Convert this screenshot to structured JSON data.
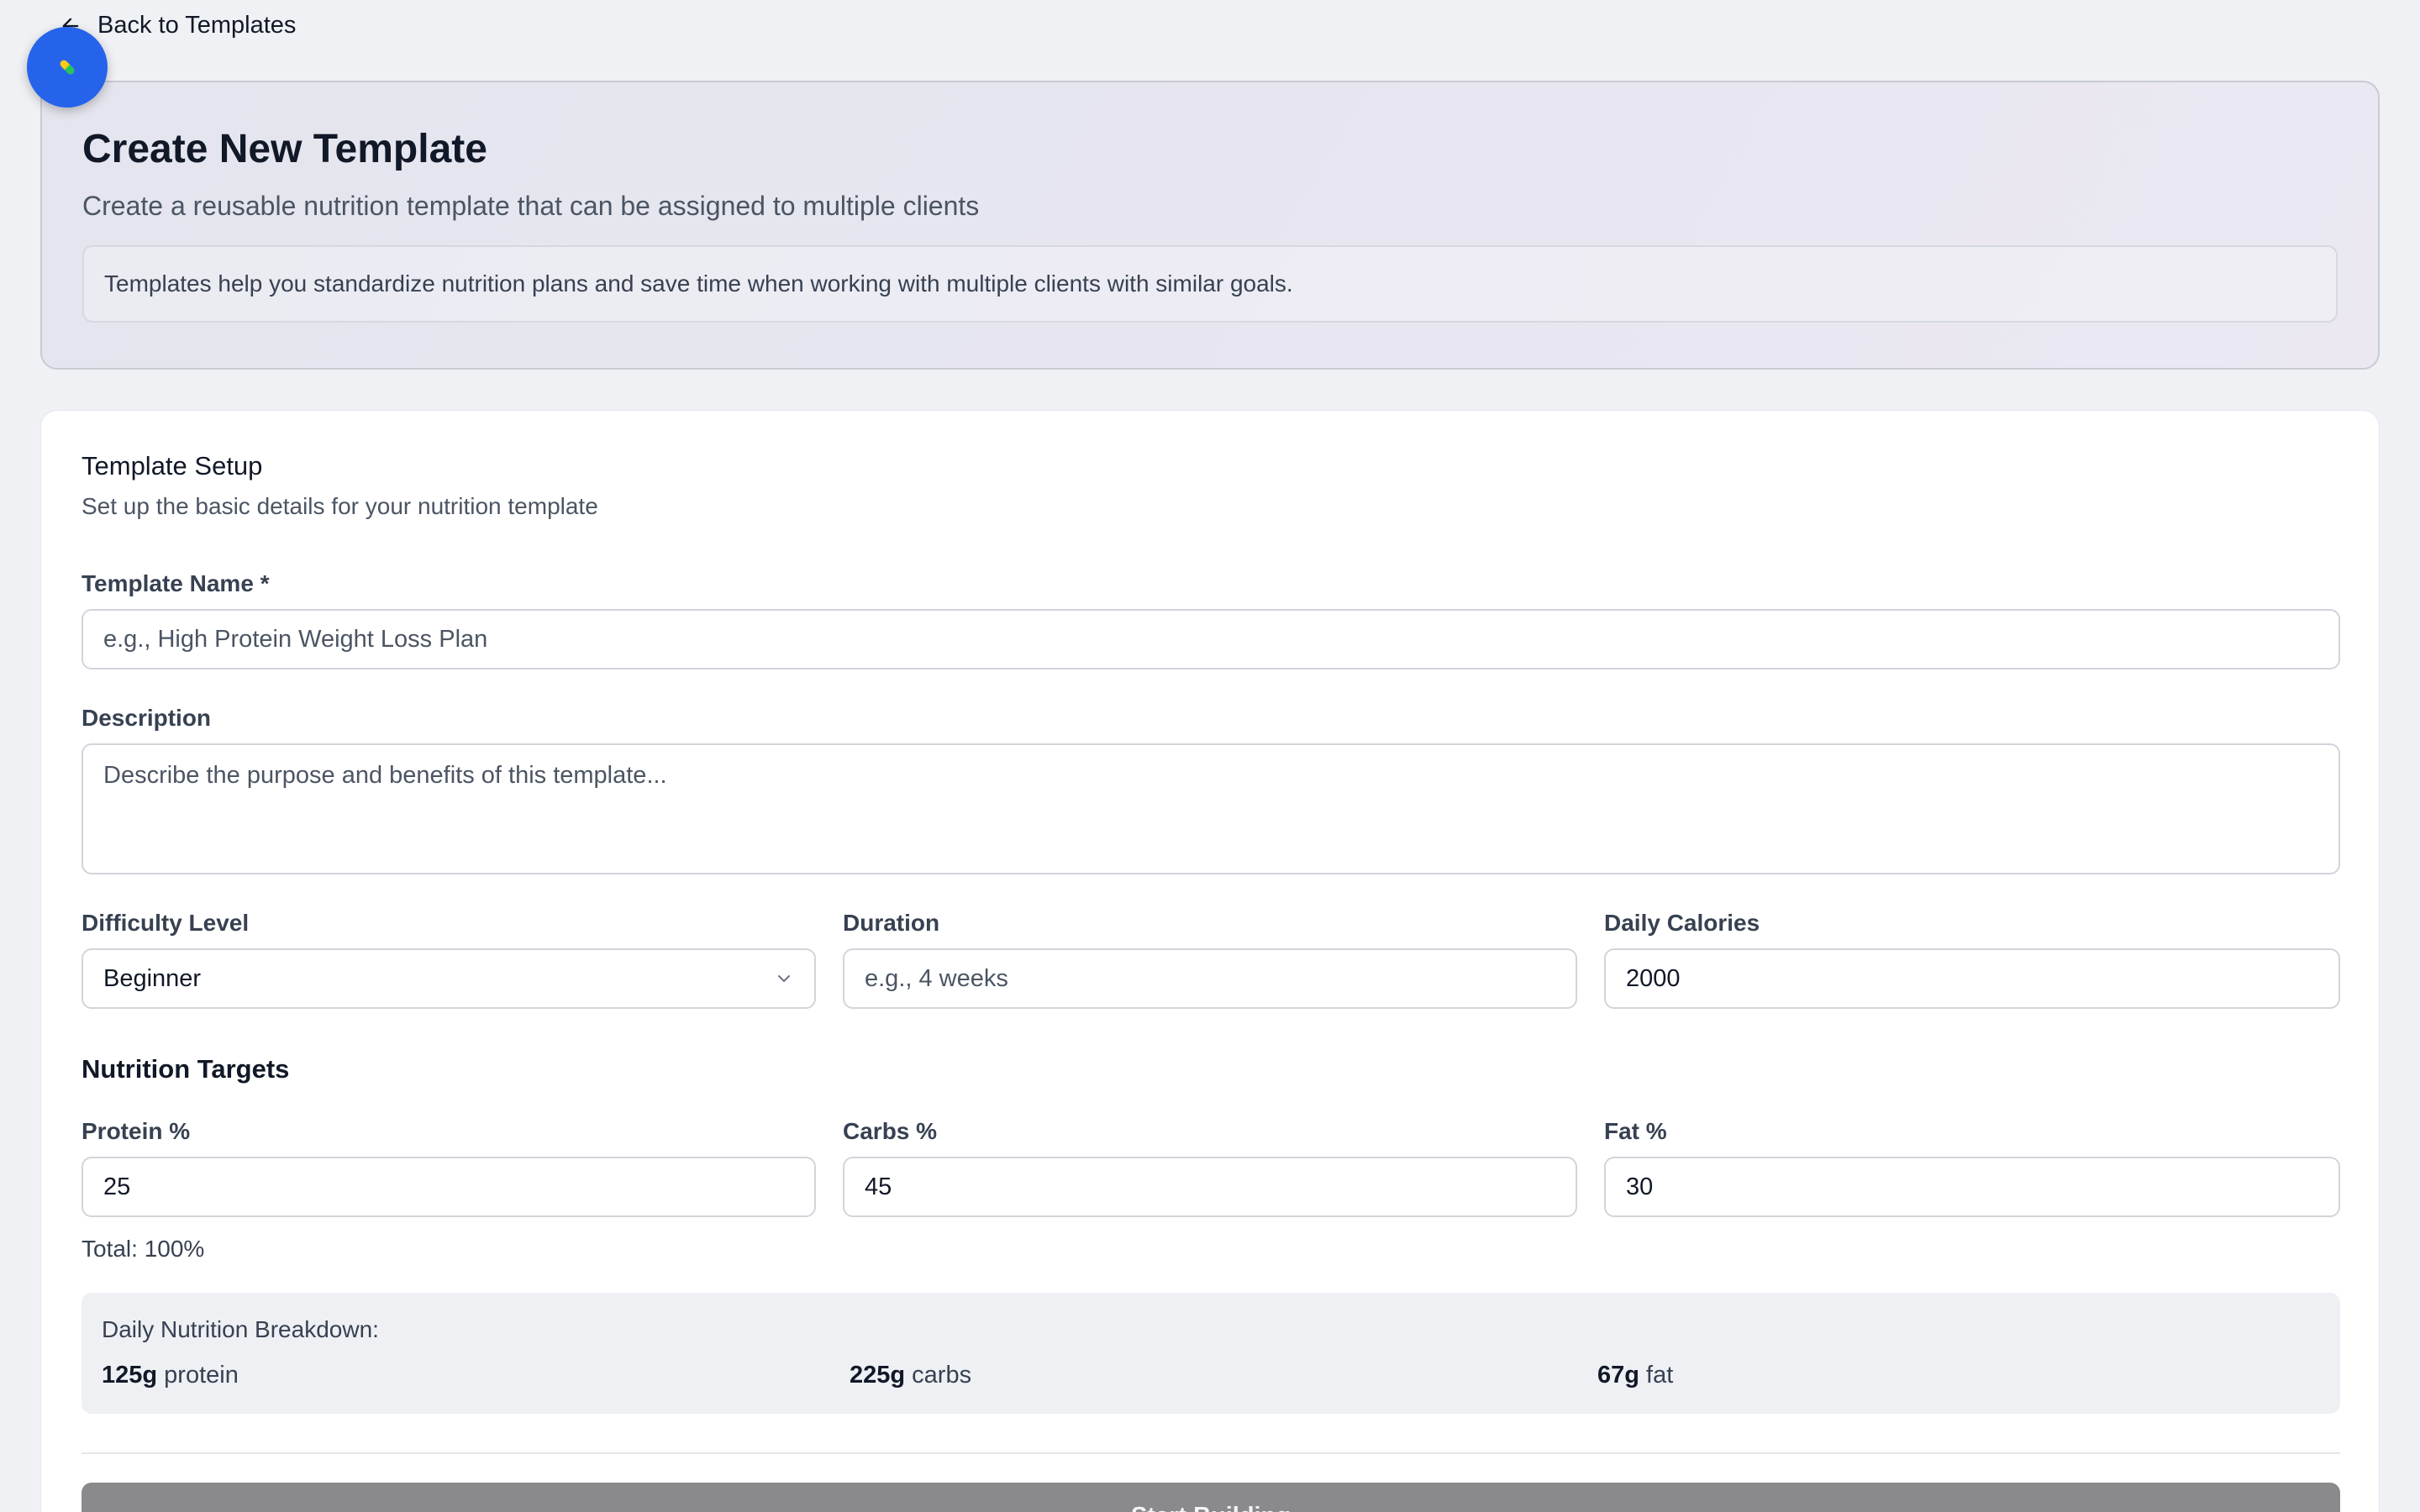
{
  "nav": {
    "back_label": "Back to Templates"
  },
  "fab": {
    "icon": "pill-icon"
  },
  "hero": {
    "title": "Create New Template",
    "subtitle": "Create a reusable nutrition template that can be assigned to multiple clients",
    "info": "Templates help you standardize nutrition plans and save time when working with multiple clients with similar goals."
  },
  "setup": {
    "title": "Template Setup",
    "subtitle": "Set up the basic details for your nutrition template",
    "name": {
      "label": "Template Name *",
      "placeholder": "e.g., High Protein Weight Loss Plan",
      "value": ""
    },
    "description": {
      "label": "Description",
      "placeholder": "Describe the purpose and benefits of this template...",
      "value": ""
    },
    "difficulty": {
      "label": "Difficulty Level",
      "value": "Beginner"
    },
    "duration": {
      "label": "Duration",
      "placeholder": "e.g., 4 weeks",
      "value": ""
    },
    "calories": {
      "label": "Daily Calories",
      "value": "2000"
    }
  },
  "targets": {
    "title": "Nutrition Targets",
    "protein": {
      "label": "Protein %",
      "value": "25"
    },
    "carbs": {
      "label": "Carbs %",
      "value": "45"
    },
    "fat": {
      "label": "Fat %",
      "value": "30"
    },
    "total": "Total: 100%"
  },
  "breakdown": {
    "title": "Daily Nutrition Breakdown:",
    "protein": {
      "amount": "125g",
      "unit": "protein"
    },
    "carbs": {
      "amount": "225g",
      "unit": "carbs"
    },
    "fat": {
      "amount": "67g",
      "unit": "fat"
    }
  },
  "submit": {
    "label": "Start Building"
  },
  "colors": {
    "accent": "#2563eb",
    "disabled_button": "#8a8a8d"
  }
}
